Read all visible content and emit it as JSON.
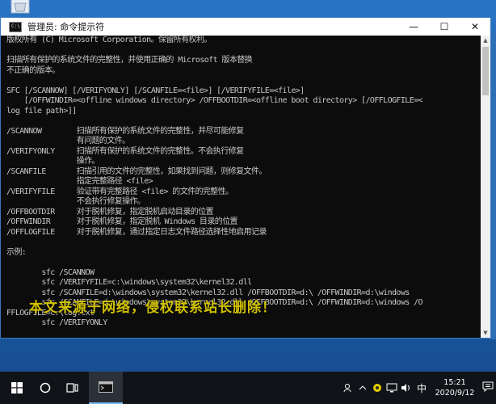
{
  "window": {
    "title": "管理员: 命令提示符",
    "minimize": "—",
    "maximize": "☐",
    "close": "✕"
  },
  "console_lines": [
    "版权所有 (C) Microsoft Corporation。保留所有权利。",
    "",
    "扫描所有保护的系统文件的完整性，并使用正确的 Microsoft 版本替换",
    "不正确的版本。",
    "",
    "SFC [/SCANNOW] [/VERIFYONLY] [/SCANFILE=<file>] [/VERIFYFILE=<file>]",
    "    [/OFFWINDIR=<offline windows directory> /OFFBOOTDIR=<offline boot directory> [/OFFLOGFILE=<",
    "log file path>]]",
    "",
    "/SCANNOW        扫描所有保护的系统文件的完整性，并尽可能修复",
    "                有问题的文件。",
    "/VERIFYONLY     扫描所有保护的系统文件的完整性。不会执行修复",
    "                操作。",
    "/SCANFILE       扫描引用的文件的完整性，如果找到问题，则修复文件。",
    "                指定完整路径 <file>",
    "/VERIFYFILE     验证带有完整路径 <file> 的文件的完整性。",
    "                不会执行修复操作。",
    "/OFFBOOTDIR     对于脱机修复，指定脱机启动目录的位置",
    "/OFFWINDIR      对于脱机修复，指定脱机 Windows 目录的位置",
    "/OFFLOGFILE     对于脱机修复，通过指定日志文件路径选择性地启用记录",
    "",
    "示例:",
    "",
    "        sfc /SCANNOW",
    "        sfc /VERIFYFILE=c:\\windows\\system32\\kernel32.dll",
    "        sfc /SCANFILE=d:\\windows\\system32\\kernel32.dll /OFFBOOTDIR=d:\\ /OFFWINDIR=d:\\windows",
    "        sfc /SCANFILE=d:\\windows\\system32\\kernel32.dll /OFFBOOTDIR=d:\\ /OFFWINDIR=d:\\windows /O",
    "FFLOGFILE=c:\\log.txt",
    "        sfc /VERIFYONLY"
  ],
  "watermark": "本文来源于网络，侵权联系站长删除！",
  "taskbar": {
    "ime_label": "中",
    "time": "15:21",
    "date": "2020/9/12"
  },
  "colors": {
    "console_bg": "#0c0c0c",
    "console_text": "#c8c8c8",
    "watermark": "#e0d000",
    "taskbar_bg": "#101318"
  }
}
